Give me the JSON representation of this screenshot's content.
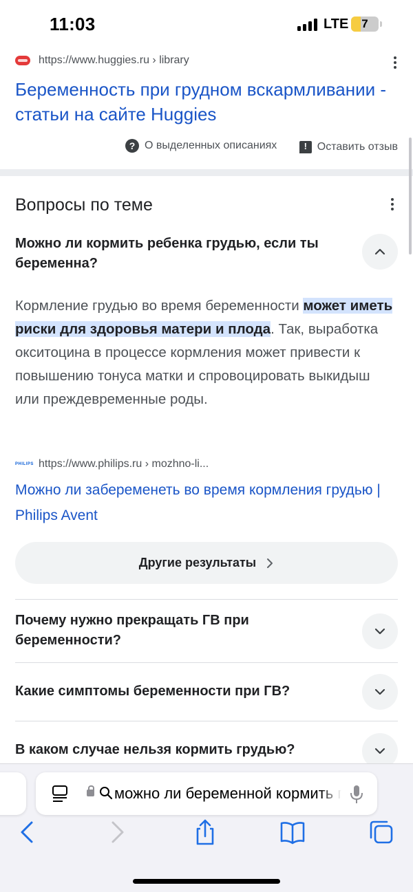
{
  "status_bar": {
    "time": "11:03",
    "network": "LTE",
    "battery": "7"
  },
  "result": {
    "url": "https://www.huggies.ru › library",
    "favicon_brand": "Huggies",
    "title": "Беременность при грудном вскармливании - статьи на сайте Huggies",
    "about_label": "О выделенных описаниях",
    "feedback_label": "Оставить отзыв"
  },
  "paa": {
    "heading": "Вопросы по теме",
    "open_question": "Можно ли кормить ребенка грудью, если ты беременна?",
    "answer_before": "Кормление грудью во время беременности ",
    "answer_highlight": "может иметь риски для здоровья матери и плода",
    "answer_after": ". Так, выработка окситоцина в процессе кормления может привести к повышению тонуса матки и спровоцировать выкидыш или преждевременные роды.",
    "source_logo": "PHILIPS",
    "source_url": "https://www.philips.ru › mozhno-li...",
    "source_title": "Можно ли забеременеть во время кормления грудью | Philips Avent",
    "more_button": "Другие результаты",
    "closed_questions": [
      "Почему нужно прекращать ГВ при беременности?",
      "Какие симптомы беременности при ГВ?",
      "В каком случае нельзя кормить грудью?"
    ]
  },
  "browser": {
    "address_text": "можно ли беременной кормить грудью"
  },
  "colors": {
    "link": "#1a55c7",
    "highlight": "#d3e3fd",
    "battery": "#f6cc41"
  }
}
